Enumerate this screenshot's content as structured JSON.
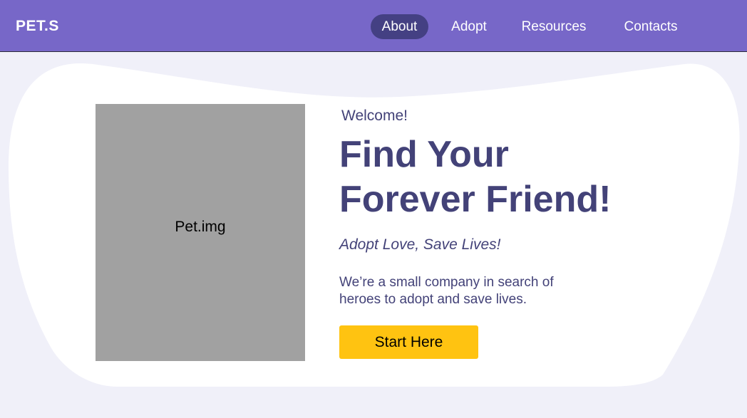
{
  "header": {
    "logo": "PET.S",
    "nav": [
      {
        "label": "About",
        "active": true
      },
      {
        "label": "Adopt",
        "active": false
      },
      {
        "label": "Resources",
        "active": false
      },
      {
        "label": "Contacts",
        "active": false
      }
    ]
  },
  "hero": {
    "image_placeholder": "Pet.img",
    "welcome": "Welcome!",
    "headline_line1": "Find Your",
    "headline_line2": "Forever Friend!",
    "tagline": "Adopt Love, Save Lives!",
    "description": "We’re a small company in search of heroes to adopt and save lives.",
    "cta_label": "Start Here"
  },
  "colors": {
    "nav_background": "#7767c8",
    "nav_active_pill": "#444083",
    "page_background": "#f0f0f9",
    "card_background": "#ffffff",
    "heading_text": "#434278",
    "cta_background": "#ffc311",
    "image_placeholder": "#a1a1a1"
  }
}
